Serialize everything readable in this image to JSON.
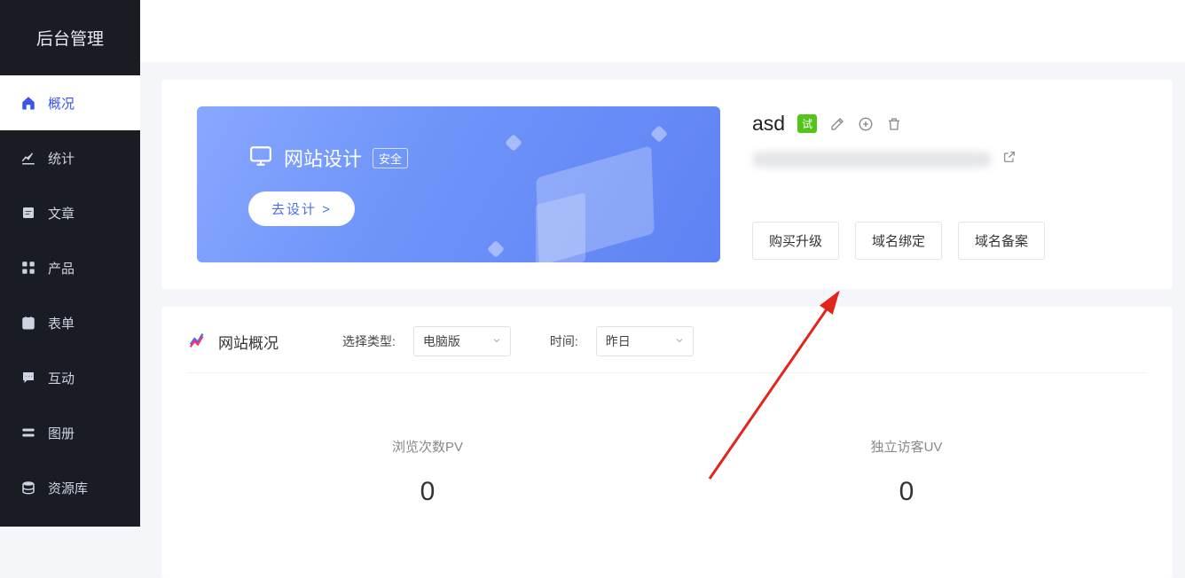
{
  "sidebar": {
    "header": "后台管理",
    "items": [
      {
        "label": "概况",
        "icon": "home"
      },
      {
        "label": "统计",
        "icon": "stats"
      },
      {
        "label": "文章",
        "icon": "article"
      },
      {
        "label": "产品",
        "icon": "product"
      },
      {
        "label": "表单",
        "icon": "form"
      },
      {
        "label": "互动",
        "icon": "chat"
      },
      {
        "label": "图册",
        "icon": "album"
      },
      {
        "label": "资源库",
        "icon": "library"
      }
    ]
  },
  "banner": {
    "title": "网站设计",
    "tag": "安全",
    "button": "去设计 >"
  },
  "site": {
    "name": "asd",
    "badge": "试",
    "buttons": {
      "buy": "购买升级",
      "bind": "域名绑定",
      "record": "域名备案"
    }
  },
  "overview": {
    "title": "网站概况",
    "type_label": "选择类型:",
    "type_value": "电脑版",
    "time_label": "时间:",
    "time_value": "昨日",
    "stats": {
      "pv_label": "浏览次数PV",
      "pv_value": "0",
      "uv_label": "独立访客UV",
      "uv_value": "0"
    }
  }
}
